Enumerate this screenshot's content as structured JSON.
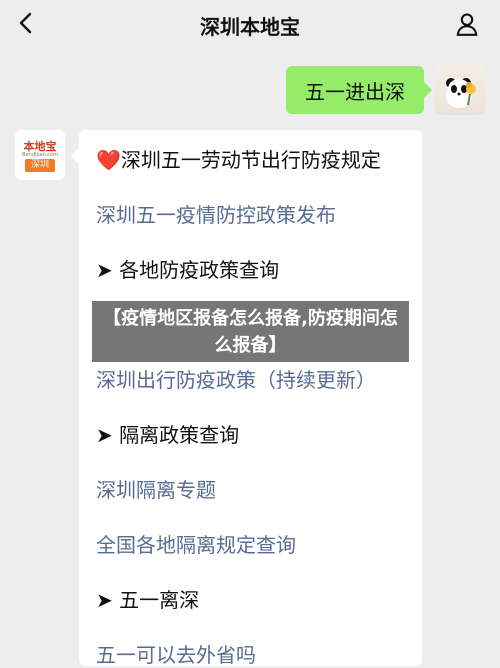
{
  "header": {
    "title": "深圳本地宝"
  },
  "messages": {
    "outgoing_text": "五一进出深",
    "brand_logo_main": "本地宝",
    "brand_logo_sub": "Bendibao.com",
    "brand_logo_city": "深圳",
    "incoming_lines": [
      {
        "text": "❤️深圳五一劳动节出行防疫规定",
        "style": "dark"
      },
      {
        "text": "深圳五一疫情防控政策发布",
        "style": "link"
      },
      {
        "text": "➤ 各地防疫政策查询",
        "style": "dark"
      },
      {
        "text": "深圳出行防疫政策（持续更新）",
        "style": "link"
      },
      {
        "text": "➤ 隔离政策查询",
        "style": "dark"
      },
      {
        "text": "深圳隔离专题",
        "style": "link"
      },
      {
        "text": "全国各地隔离规定查询",
        "style": "link"
      },
      {
        "text": "➤ 五一离深",
        "style": "dark"
      },
      {
        "text": "五一可以去外省吗",
        "style": "link"
      }
    ]
  },
  "overlay": {
    "line1": "【疫情地区报备怎么报备,防疫期间怎",
    "line2": "么报备】"
  }
}
